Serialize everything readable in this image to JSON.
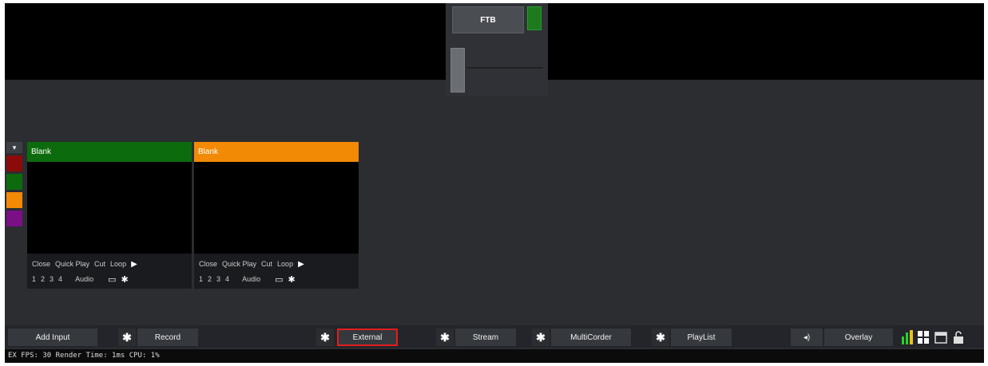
{
  "transition": {
    "ftb_label": "FTB"
  },
  "side_colors": [
    "#8b0a0a",
    "#0c6b0c",
    "#f28a06",
    "#7a0f86"
  ],
  "inputs": [
    {
      "title": "Blank",
      "title_color": "#0c6b0c",
      "controls": [
        "Close",
        "Quick Play",
        "Cut",
        "Loop"
      ],
      "numbers": [
        "1",
        "2",
        "3",
        "4"
      ],
      "audio_label": "Audio"
    },
    {
      "title": "Blank",
      "title_color": "#f28a06",
      "controls": [
        "Close",
        "Quick Play",
        "Cut",
        "Loop"
      ],
      "numbers": [
        "1",
        "2",
        "3",
        "4"
      ],
      "audio_label": "Audio"
    }
  ],
  "toolbar": {
    "add_input": "Add Input",
    "record": "Record",
    "external": "External",
    "stream": "Stream",
    "multicorder": "MultiCorder",
    "playlist": "PlayList",
    "overlay": "Overlay"
  },
  "status": {
    "text": "EX FPS: 30 Render Time: 1ms CPU: 1%"
  },
  "colors": {
    "highlight": "#e31d1d"
  }
}
